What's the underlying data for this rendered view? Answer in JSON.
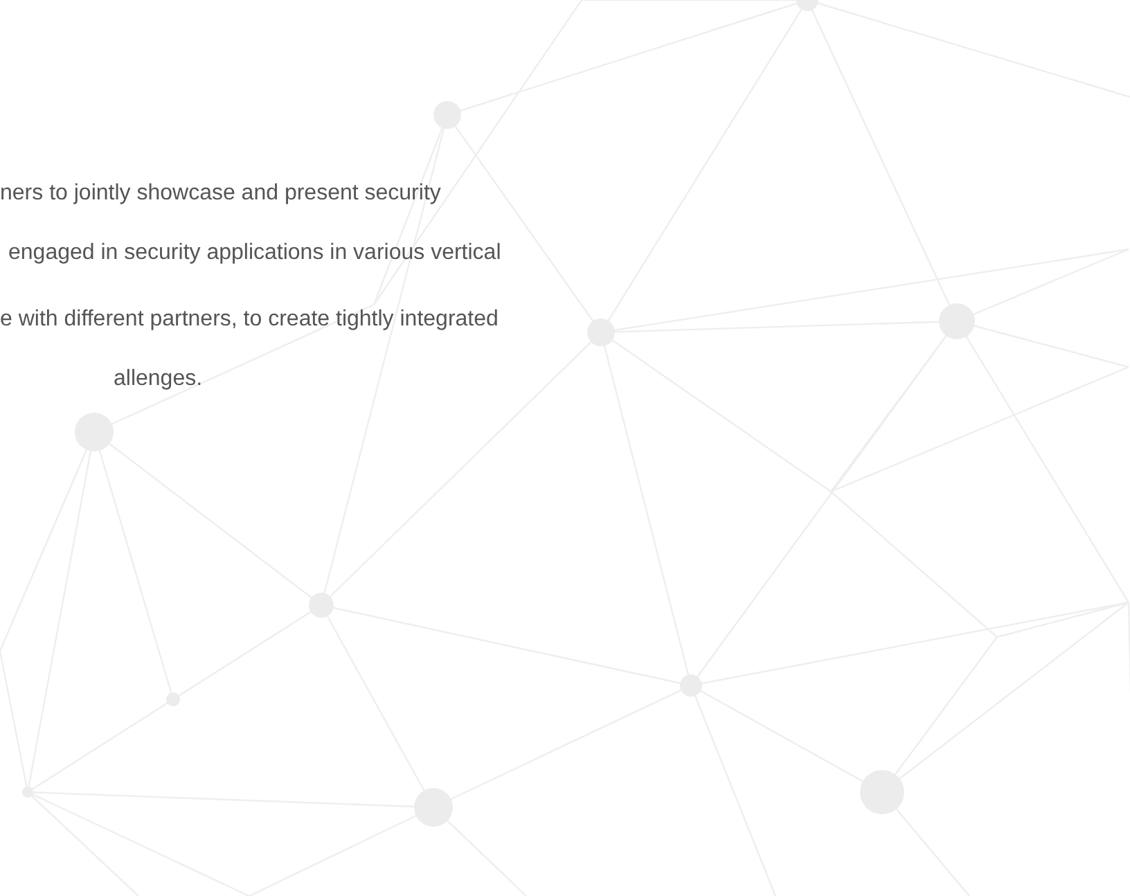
{
  "paragraphs": [
    {
      "lines": [
        "ners to jointly showcase and present security",
        "engaged in security applications in various vertical"
      ]
    },
    {
      "lines": [
        "e with different partners, to create tightly integrated",
        "allenges."
      ]
    }
  ]
}
